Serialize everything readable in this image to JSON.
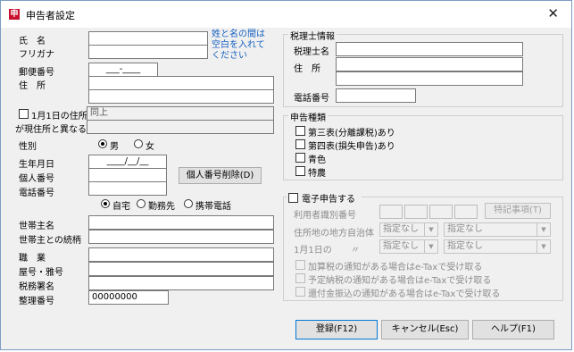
{
  "window": {
    "title": "申告者設定",
    "close_glyph": "✕",
    "icon_glyph": "申"
  },
  "left": {
    "name_label": "氏　名",
    "furigana_label": "フリガナ",
    "name_hint": "姓と名の間は 空白を入れて ください",
    "postal_label": "郵便番号",
    "postal_value": "___-____",
    "address_label": "住　所",
    "jan1_checkbox_label": "1月1日の住所",
    "jan1_label2": "が現住所と異なる",
    "jan1_value": "同上",
    "gender_label": "性別",
    "gender_male": "男",
    "gender_female": "女",
    "birth_label": "生年月日",
    "birth_value": "____/__/__",
    "mynumber_label": "個人番号",
    "mynumber_delete_button": "個人番号削除(D)",
    "phone_label": "電話番号",
    "phone_home": "自宅",
    "phone_work": "勤務先",
    "phone_mobile": "携帯電話",
    "household_head_label": "世帯主名",
    "household_rel_label": "世帯主との続柄",
    "occupation_label": "職　業",
    "shop_label": "屋号・雅号",
    "taxoffice_label": "税務署名",
    "serial_label": "整理番号",
    "serial_value": "00000000"
  },
  "accountant": {
    "group_title": "税理士情報",
    "name_label": "税理士名",
    "address_label": "住　所",
    "phone_label": "電話番号"
  },
  "declaration": {
    "group_title": "申告種類",
    "items": [
      "第三表(分離課税)あり",
      "第四表(損失申告)あり",
      "青色",
      "特農"
    ]
  },
  "etax": {
    "checkbox_label": "電子申告する",
    "user_id_label": "利用者識別番号",
    "special_button": "特記事項(T)",
    "municipality_label": "住所地の地方自治体",
    "jan1_label": "1月1日の",
    "ditto": "〃",
    "select_none": "指定なし",
    "notify_items": [
      "加算税の通知がある場合はe-Taxで受け取る",
      "予定納税の通知がある場合はe-Taxで受け取る",
      "還付金振込の通知がある場合はe-Taxで受け取る"
    ]
  },
  "footer": {
    "register": "登録(F12)",
    "cancel": "キャンセル(Esc)",
    "help": "ヘルプ(F1)"
  }
}
